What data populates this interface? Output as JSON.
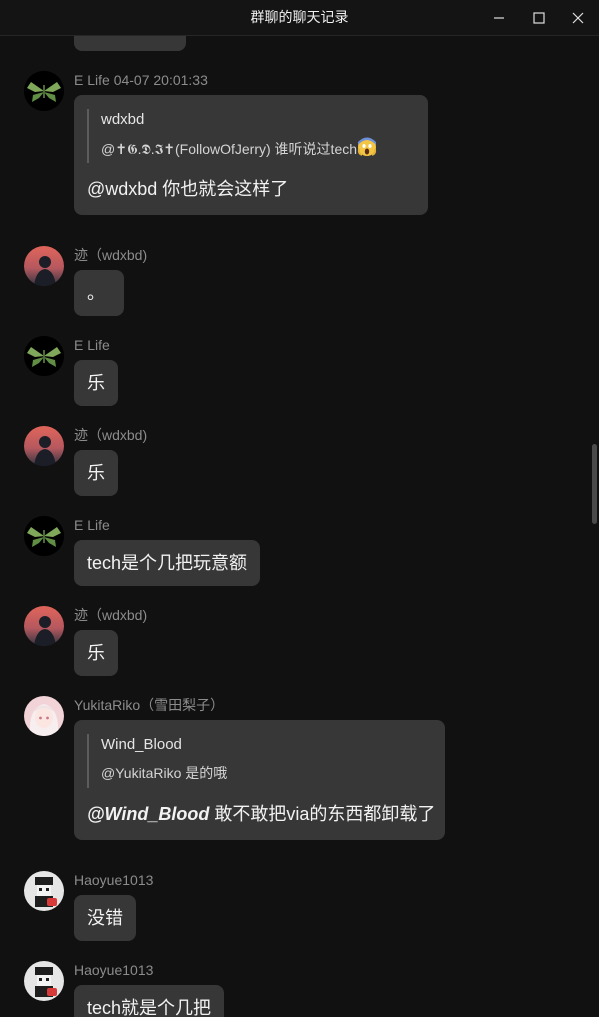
{
  "window": {
    "title": "群聊的聊天记录",
    "minimize_icon": "minimize-icon",
    "maximize_icon": "maximize-icon",
    "close_icon": "close-icon"
  },
  "messages": [
    {
      "sender": "E Life 04-07 20:01:33",
      "avatar": "moth-avatar",
      "reply": {
        "name": "wdxbd",
        "text": "@✝𝕲.𝕯.𝕴✝(FollowOfJerry) 谁听说过tech",
        "emoji": "scream-emoji"
      },
      "text": "@wdxbd 你也就会这样了"
    },
    {
      "sender": "迹（wdxbd)",
      "avatar": "sunset-avatar",
      "text": "。"
    },
    {
      "sender": "E Life",
      "avatar": "moth-avatar",
      "text": "乐"
    },
    {
      "sender": "迹（wdxbd)",
      "avatar": "sunset-avatar",
      "text": "乐"
    },
    {
      "sender": "E Life",
      "avatar": "moth-avatar",
      "text": "tech是个几把玩意额"
    },
    {
      "sender": "迹（wdxbd)",
      "avatar": "sunset-avatar",
      "text": "乐"
    },
    {
      "sender": "YukitaRiko（雪田梨子）",
      "avatar": "anime-girl-avatar",
      "reply": {
        "name": "Wind_Blood",
        "text": "@YukitaRiko 是的哦"
      },
      "mention": "@Wind_Blood",
      "text": " 敢不敢把via的东西都卸载了"
    },
    {
      "sender": "Haoyue1013",
      "avatar": "pixel-avatar",
      "text": "没错"
    },
    {
      "sender": "Haoyue1013",
      "avatar": "pixel-avatar",
      "text": "tech就是个几把"
    }
  ],
  "colors": {
    "background": "#111111",
    "bubble": "#373737",
    "sender_text": "#8c8c8c",
    "message_text": "#f2f2f2"
  }
}
